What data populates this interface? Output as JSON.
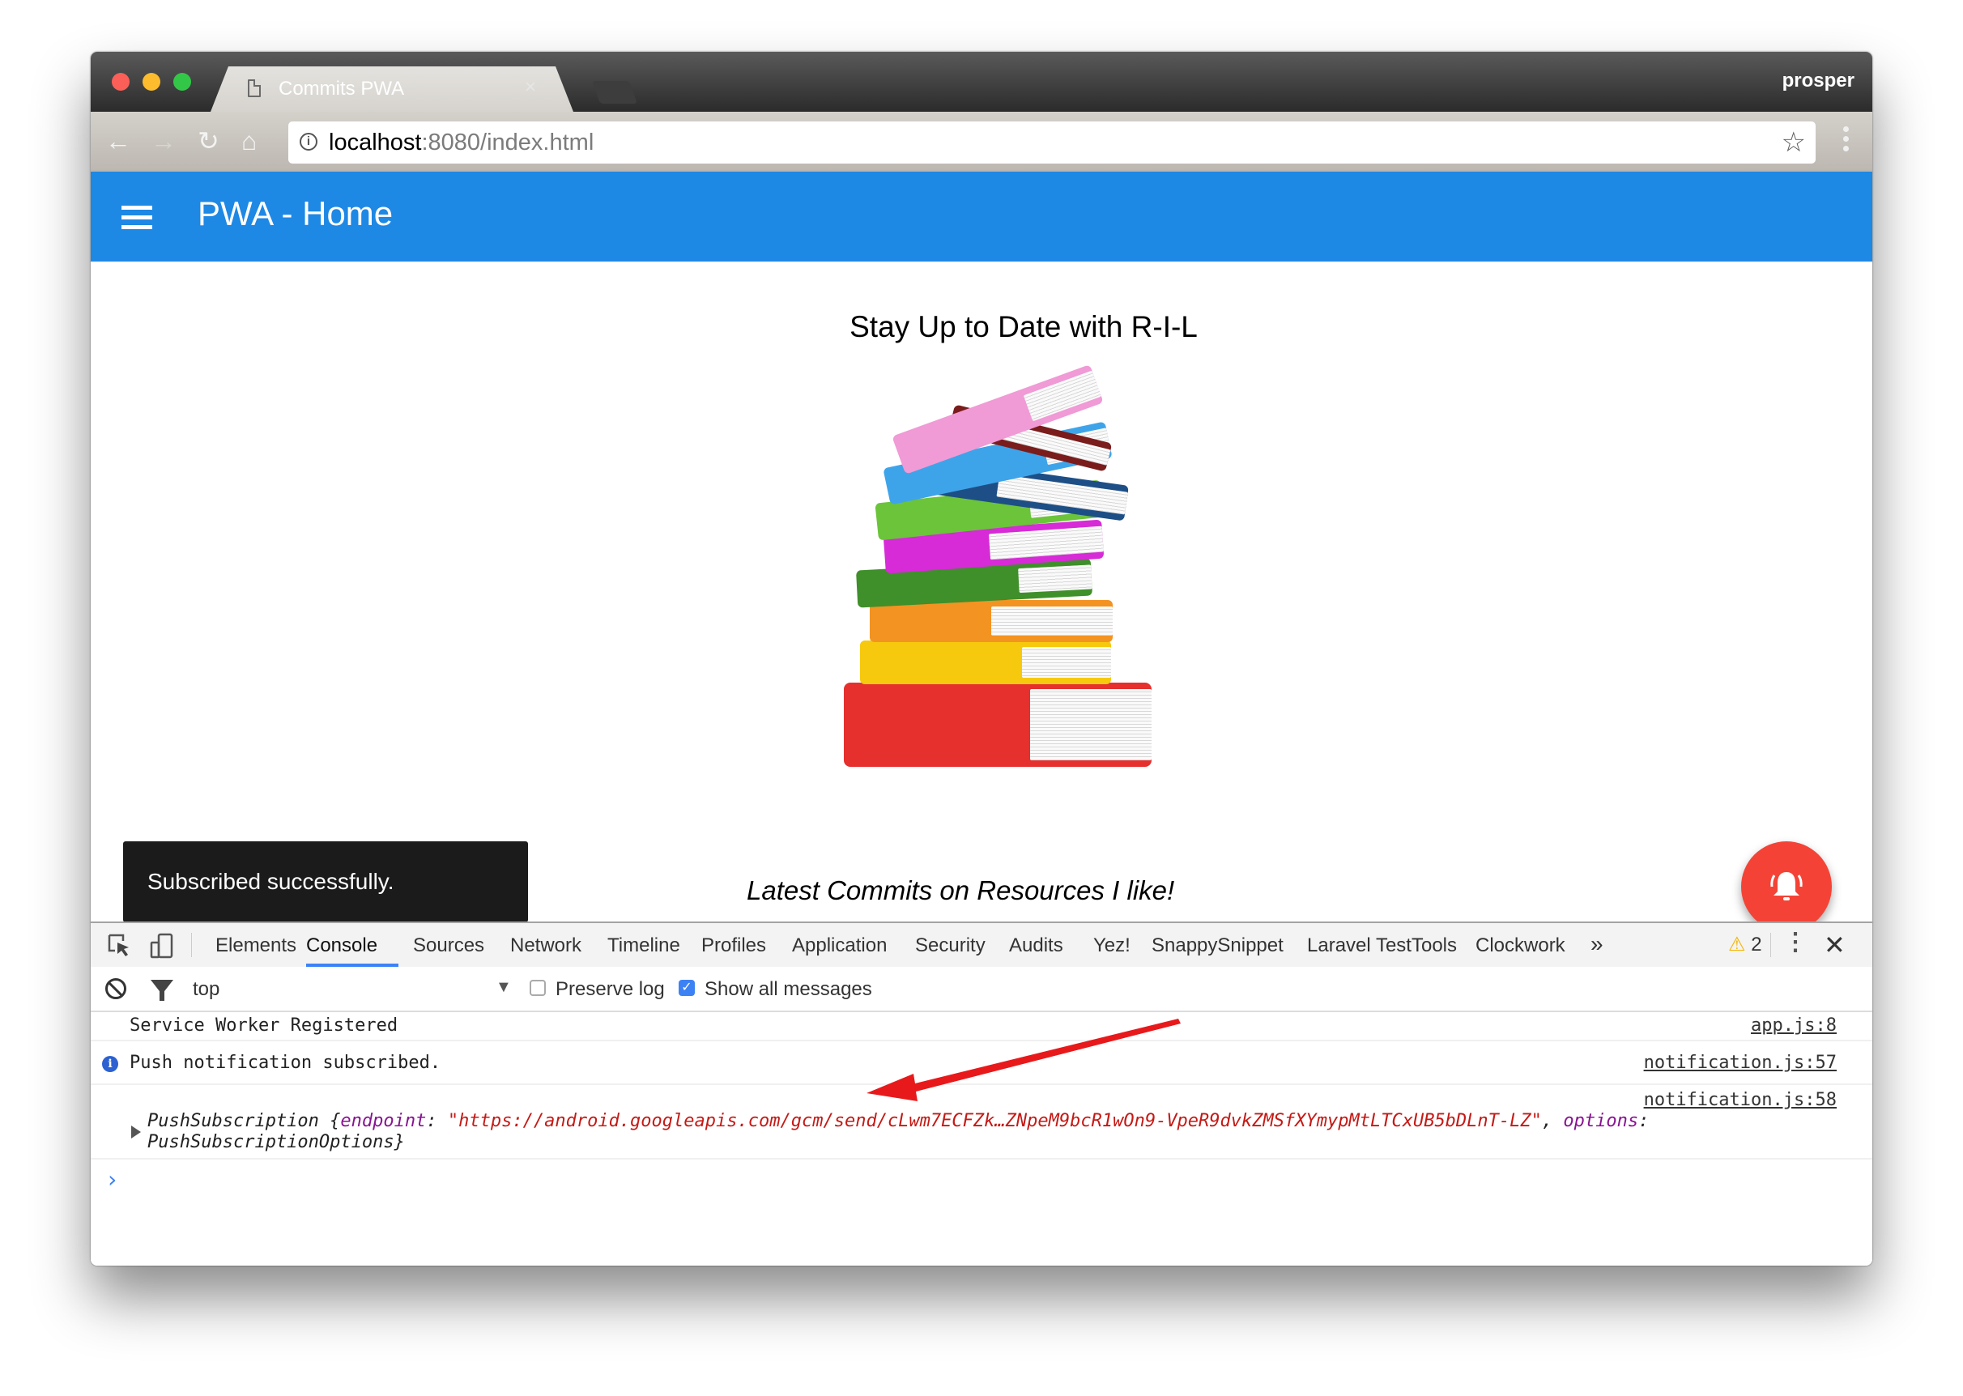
{
  "browser": {
    "tab_title": "Commits PWA",
    "tab_close": "×",
    "profile_name": "prosper",
    "url_host": "localhost",
    "url_rest": ":8080/index.html",
    "nav": {
      "back": "←",
      "forward": "→",
      "reload": "↻",
      "home": "⌂"
    },
    "info_glyph": "i",
    "star_glyph": "☆"
  },
  "app": {
    "title": "PWA - Home",
    "headline": "Stay Up to Date with R-I-L",
    "subtitle": "Latest Commits on Resources I like!",
    "toast": "Subscribed successfully.",
    "colors": {
      "appbar": "#1e88e5",
      "fab": "#f44336",
      "toast": "#1b1b1b"
    }
  },
  "devtools": {
    "tabs": [
      "Elements",
      "Console",
      "Sources",
      "Network",
      "Timeline",
      "Profiles",
      "Application",
      "Security",
      "Audits",
      "Yez!",
      "SnappySnippet",
      "Laravel TestTools",
      "Clockwork"
    ],
    "active_tab": "Console",
    "overflow": "»",
    "warning_count": "2",
    "warning_glyph": "⚠",
    "close_glyph": "✕",
    "filter": {
      "context": "top",
      "context_arrow": "▼",
      "preserve_log_label": "Preserve log",
      "preserve_log_checked": false,
      "show_all_label": "Show all messages",
      "show_all_checked": true,
      "check_glyph": "✓"
    },
    "messages": [
      {
        "text": "Service Worker Registered",
        "source": "app.js:8",
        "level": "log"
      },
      {
        "text": "Push notification subscribed.",
        "source": "notification.js:57",
        "level": "info"
      },
      {
        "source": "notification.js:58",
        "level": "log",
        "object_name": "PushSubscription",
        "open_brace": " {",
        "key1": "endpoint",
        "colon": ": ",
        "value1": "\"https://android.googleapis.com/gcm/send/cLwm7ECFZk…ZNpeM9bcR1wOn9-VpeR9dvkZMSfXYmypMtLTCxUB5bDLnT-LZ\"",
        "comma": ", ",
        "key2": "options",
        "colon2": ":",
        "value2": "PushSubscriptionOptions}"
      }
    ],
    "prompt": "›",
    "info_glyph": "i"
  }
}
